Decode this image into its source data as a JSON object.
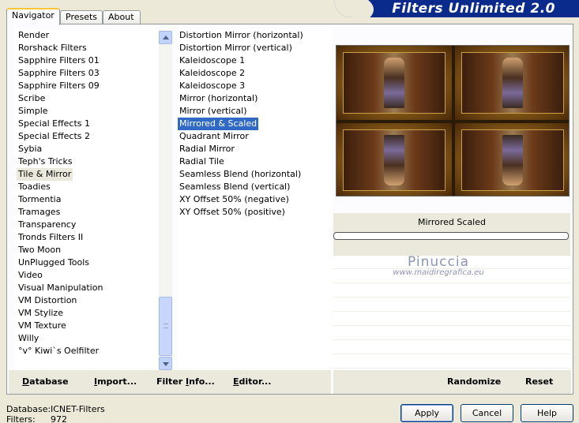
{
  "tabs": [
    {
      "label": "Navigator",
      "active": true
    },
    {
      "label": "Presets",
      "active": false
    },
    {
      "label": "About",
      "active": false
    }
  ],
  "app_title": "Filters Unlimited 2.0",
  "categories": [
    "Render",
    "Rorshack Filters",
    "Sapphire Filters 01",
    "Sapphire Filters 03",
    "Sapphire Filters 09",
    "Scribe",
    "Simple",
    "Special Effects 1",
    "Special Effects 2",
    "Sybia",
    "Teph's Tricks",
    "Tile & Mirror",
    "Toadies",
    "Tormentia",
    "Tramages",
    "Transparency",
    "Tronds Filters II",
    "Two Moon",
    "UnPlugged Tools",
    "Video",
    "Visual Manipulation",
    "VM Distortion",
    "VM Stylize",
    "VM Texture",
    "Willy",
    "°v° Kiwi`s Oelfilter"
  ],
  "selected_category": "Tile & Mirror",
  "filters": [
    "Distortion Mirror (horizontal)",
    "Distortion Mirror (vertical)",
    "Kaleidoscope 1",
    "Kaleidoscope 2",
    "Kaleidoscope 3",
    "Mirror (horizontal)",
    "Mirror (vertical)",
    "Mirrored & Scaled",
    "Quadrant Mirror",
    "Radial Mirror",
    "Radial Tile",
    "Seamless Blend (horizontal)",
    "Seamless Blend (vertical)",
    "XY Offset 50% (negative)",
    "XY Offset 50% (positive)"
  ],
  "selected_filter": "Mirrored & Scaled",
  "filter_name_display": "Mirrored  Scaled",
  "watermark": {
    "line1": "Pinuccia",
    "line2": "www.maidiregrafica.eu"
  },
  "bottom_links": {
    "database": {
      "pre": "",
      "u": "D",
      "post": "atabase"
    },
    "import": {
      "pre": "",
      "u": "I",
      "post": "mport..."
    },
    "filter_info": {
      "pre": "Filter ",
      "u": "I",
      "post": "nfo..."
    },
    "editor": {
      "pre": "",
      "u": "E",
      "post": "ditor..."
    },
    "randomize": "Randomize",
    "reset": "Reset"
  },
  "footer": {
    "database_label": "Database:",
    "database_value": "ICNET-Filters",
    "filters_label": "Filters:",
    "filters_value": "972"
  },
  "buttons": {
    "apply": "Apply",
    "cancel": "Cancel",
    "help": "Help"
  },
  "colors": {
    "selection": "#316ac5",
    "banner": "#0a2a8c",
    "tab_accent": "#ffc83c"
  }
}
